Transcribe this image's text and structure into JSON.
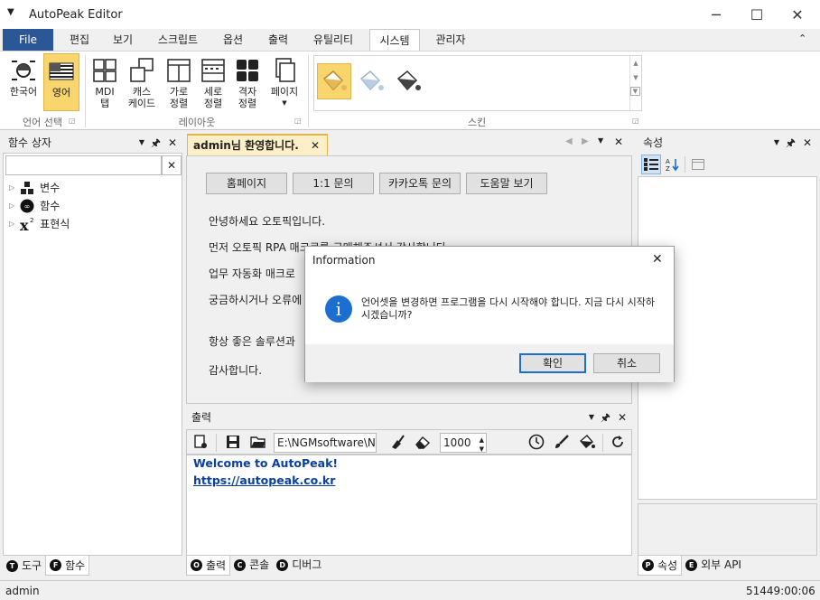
{
  "window": {
    "title": "AutoPeak Editor"
  },
  "ribbon": {
    "tabs": [
      {
        "label": "File"
      },
      {
        "label": "편집"
      },
      {
        "label": "보기"
      },
      {
        "label": "스크립트"
      },
      {
        "label": "옵션"
      },
      {
        "label": "출력"
      },
      {
        "label": "유틸리티"
      },
      {
        "label": "시스템"
      },
      {
        "label": "관리자"
      }
    ],
    "lang_group": {
      "korean": "한국어",
      "english": "영어",
      "label": "언어 선택"
    },
    "layout_group": {
      "mdi": "MDI\n탭",
      "cascade": "캐스\n케이드",
      "horizontal": "가로\n정렬",
      "vertical": "세로\n정렬",
      "grid": "격자\n정렬",
      "page": "페이지",
      "label": "레이아웃"
    },
    "skin_group": {
      "label": "스킨"
    }
  },
  "function_panel": {
    "title": "함수 상자",
    "search_value": "",
    "tree": [
      {
        "label": "변수"
      },
      {
        "label": "함수"
      },
      {
        "label": "표현식"
      }
    ],
    "tabs": [
      {
        "letter": "T",
        "label": "도구"
      },
      {
        "letter": "F",
        "label": "함수"
      }
    ]
  },
  "document": {
    "tab_label": "admin님 환영합니다.",
    "buttons": [
      "홈페이지",
      "1:1 문의",
      "카카오톡 문의",
      "도움말 보기"
    ],
    "lines": [
      "안녕하세요 오토픽입니다.",
      "먼저 오토픽 RPA 매크로를 구매해주셔서 감사합니다.",
      "업무 자동화 매크로",
      "궁금하시거나 오류에",
      "항상 좋은 솔루션과",
      "감사합니다."
    ]
  },
  "output_panel": {
    "title": "출력",
    "path_value": "E:\\NGMsoftware\\NG",
    "count_value": "1000",
    "welcome": "Welcome to AutoPeak!",
    "link": "https://autopeak.co.kr",
    "tabs": [
      {
        "letter": "O",
        "label": "출력"
      },
      {
        "letter": "C",
        "label": "콘솔"
      },
      {
        "letter": "D",
        "label": "디버그"
      }
    ]
  },
  "properties_panel": {
    "title": "속성",
    "tabs": [
      {
        "letter": "P",
        "label": "속성"
      },
      {
        "letter": "E",
        "label": "외부 API"
      }
    ]
  },
  "dialog": {
    "title": "Information",
    "message": "언어셋을 변경하면 프로그램을 다시 시작해야 합니다. 지금 다시 시작하시겠습니까?",
    "ok_label": "확인",
    "cancel_label": "취소"
  },
  "status": {
    "user": "admin",
    "time": "51449:00:06"
  },
  "colors": {
    "accent": "#2b5797",
    "selected": "#f9d56e",
    "link": "#0b3fa3",
    "info": "#1c6fd0"
  }
}
